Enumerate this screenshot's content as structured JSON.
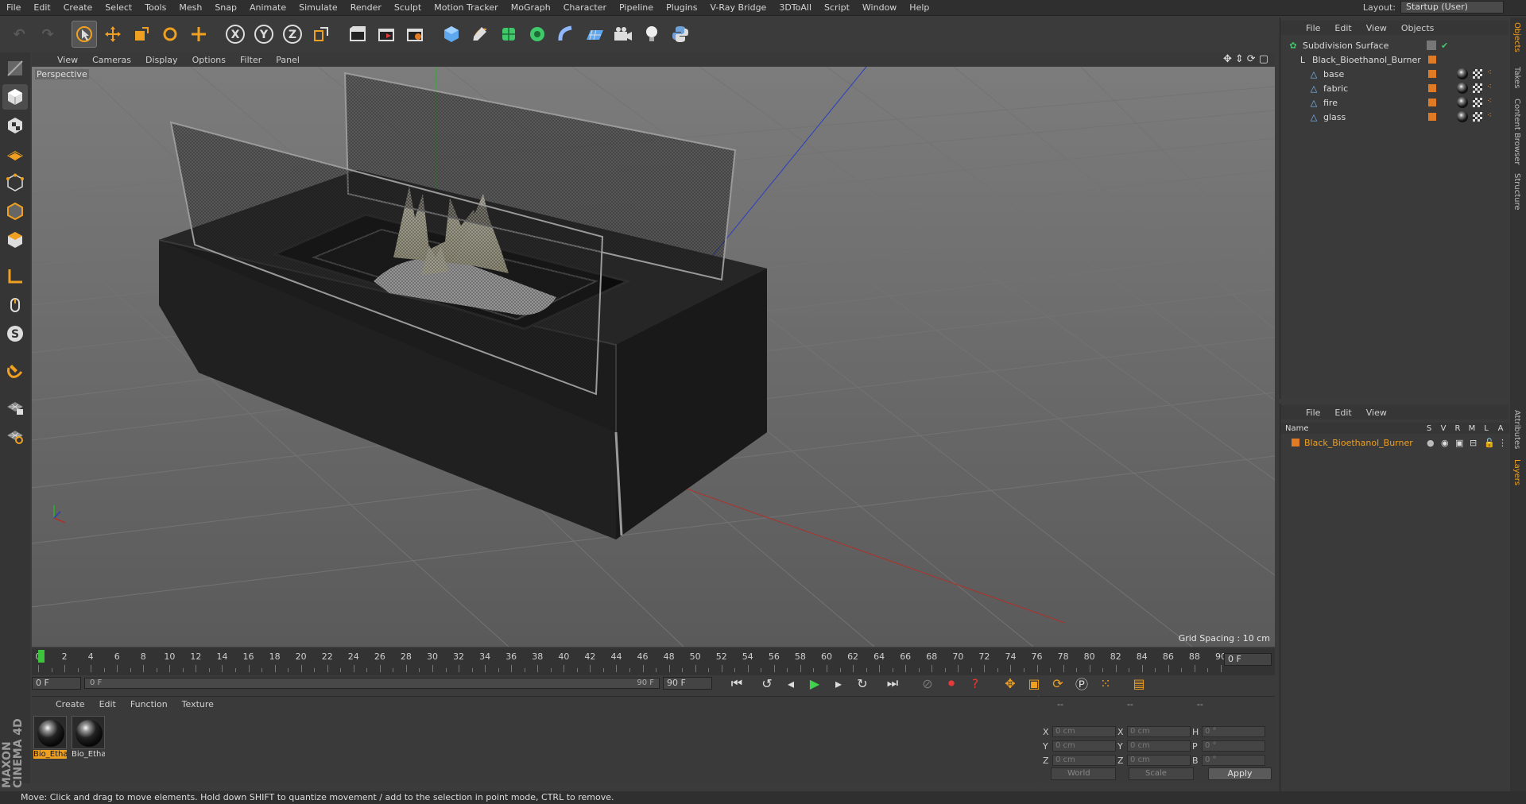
{
  "app": {
    "brand_top": "MAXON",
    "brand_bottom": "CINEMA 4D"
  },
  "menubar": {
    "items": [
      "File",
      "Edit",
      "Create",
      "Select",
      "Tools",
      "Mesh",
      "Snap",
      "Animate",
      "Simulate",
      "Render",
      "Sculpt",
      "Motion Tracker",
      "MoGraph",
      "Character",
      "Pipeline",
      "Plugins",
      "V-Ray Bridge",
      "3DToAll",
      "Script",
      "Window",
      "Help"
    ],
    "layout_label": "Layout:",
    "layout_value": "Startup (User)"
  },
  "toolbar": {
    "undo": "↶",
    "redo": "↷",
    "axes": [
      "X",
      "Y",
      "Z"
    ]
  },
  "viewport": {
    "menu": [
      "View",
      "Cameras",
      "Display",
      "Options",
      "Filter",
      "Panel"
    ],
    "label": "Perspective",
    "grid_spacing": "Grid Spacing : 10 cm"
  },
  "timeline": {
    "ticks": [
      "0",
      "2",
      "4",
      "6",
      "8",
      "10",
      "12",
      "14",
      "16",
      "18",
      "20",
      "22",
      "24",
      "26",
      "28",
      "30",
      "32",
      "34",
      "36",
      "38",
      "40",
      "42",
      "44",
      "46",
      "48",
      "50",
      "52",
      "54",
      "56",
      "58",
      "60",
      "62",
      "64",
      "66",
      "68",
      "70",
      "72",
      "74",
      "76",
      "78",
      "80",
      "82",
      "84",
      "86",
      "88",
      "90"
    ],
    "current_frame": "0 F"
  },
  "transport": {
    "start_field": "0 F",
    "range_start": "0 F",
    "range_end": "90 F",
    "end_field": "90 F"
  },
  "materials": {
    "menu": [
      "Create",
      "Edit",
      "Function",
      "Texture"
    ],
    "items": [
      {
        "label": "Bio_Etha",
        "selected": true
      },
      {
        "label": "Bio_Etha",
        "selected": false
      }
    ]
  },
  "coords": {
    "headers": [
      "--",
      "--",
      "--"
    ],
    "rows": [
      {
        "a1": "X",
        "v1": "0 cm",
        "a2": "X",
        "v2": "0 cm",
        "a3": "H",
        "v3": "0 °"
      },
      {
        "a1": "Y",
        "v1": "0 cm",
        "a2": "Y",
        "v2": "0 cm",
        "a3": "P",
        "v3": "0 °"
      },
      {
        "a1": "Z",
        "v1": "0 cm",
        "a2": "Z",
        "v2": "0 cm",
        "a3": "B",
        "v3": "0 °"
      }
    ],
    "mode": "World",
    "scale": "Scale",
    "apply": "Apply"
  },
  "objects_panel": {
    "menu": [
      "File",
      "Edit",
      "View",
      "Objects"
    ],
    "items": [
      {
        "name": "Subdivision Surface",
        "depth": 0
      },
      {
        "name": "Black_Bioethanol_Burner",
        "depth": 1
      },
      {
        "name": "base",
        "depth": 2
      },
      {
        "name": "fabric",
        "depth": 2
      },
      {
        "name": "fire",
        "depth": 2
      },
      {
        "name": "glass",
        "depth": 2
      }
    ]
  },
  "layers_panel": {
    "menu": [
      "File",
      "Edit",
      "View"
    ],
    "columns": [
      "Name",
      "S",
      "V",
      "R",
      "M",
      "L",
      "A"
    ],
    "rows": [
      {
        "name": "Black_Bioethanol_Burner"
      }
    ]
  },
  "side_tabs": [
    "Objects",
    "Takes",
    "Content Browser",
    "Structure",
    "Attributes",
    "Layers"
  ],
  "status": {
    "text": "Move: Click and drag to move elements. Hold down SHIFT to quantize movement / add to the selection in point mode, CTRL to remove."
  },
  "colors": {
    "accent": "#f0a020",
    "playhead": "#3dc43d",
    "layer_orange": "#e07a25"
  }
}
